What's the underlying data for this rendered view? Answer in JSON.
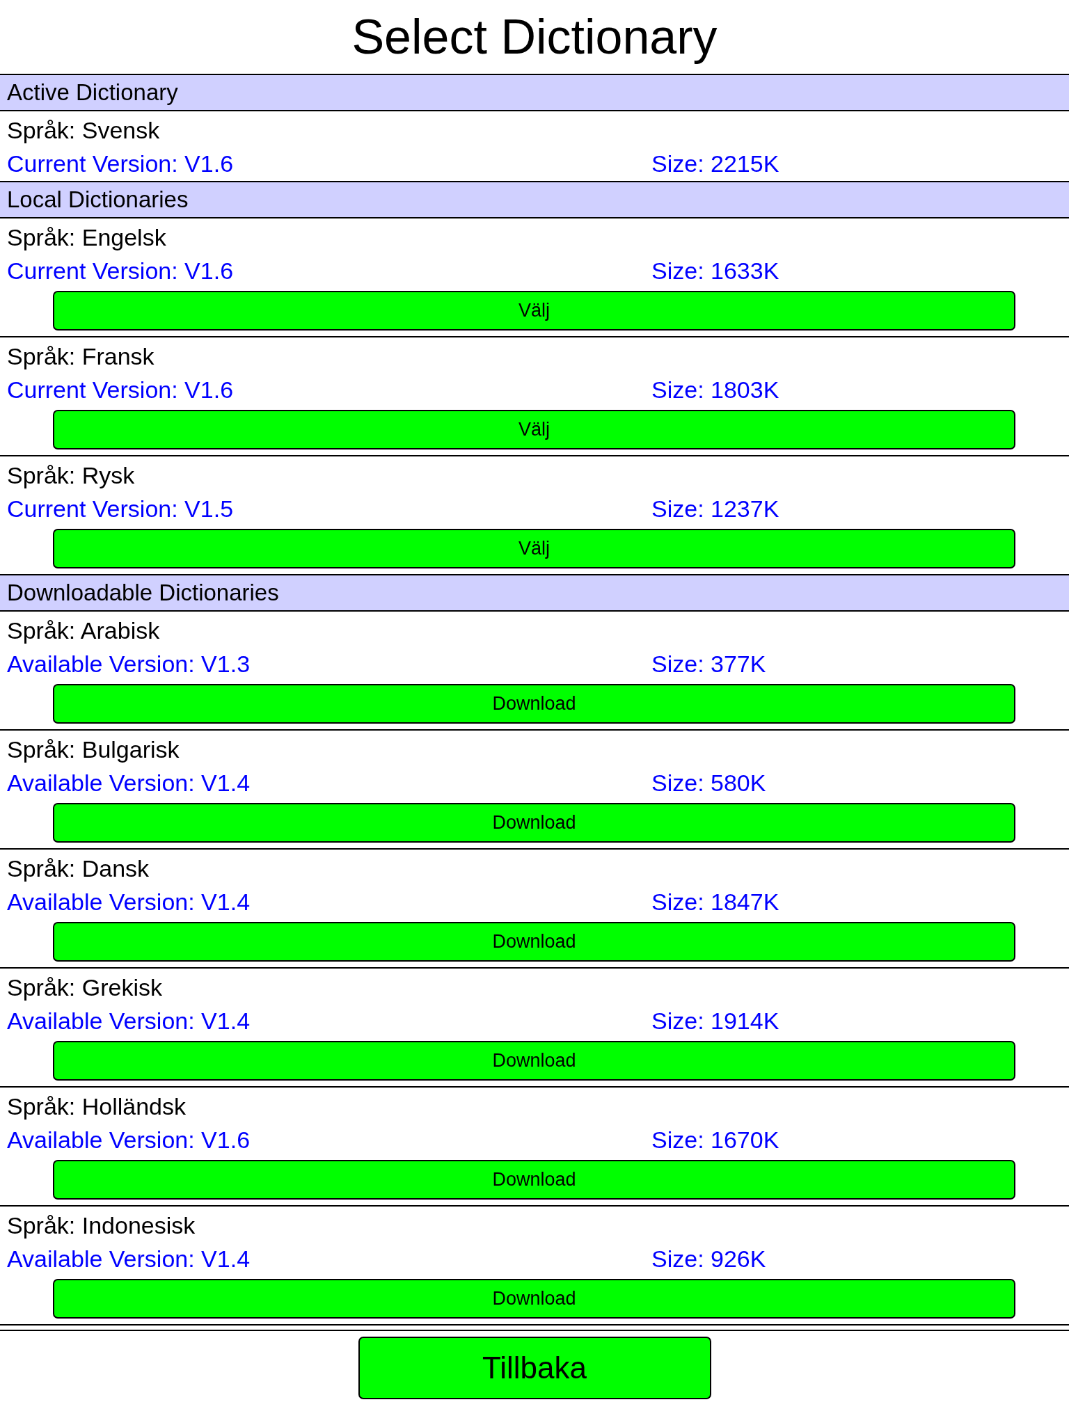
{
  "title": "Select Dictionary",
  "sections": [
    {
      "heading": "Active Dictionary",
      "items": [
        {
          "language": "Språk: Svensk",
          "version": "Current Version: V1.6",
          "size": "Size: 2215K"
        }
      ]
    },
    {
      "heading": "Local Dictionaries",
      "items": [
        {
          "language": "Språk: Engelsk",
          "version": "Current Version: V1.6",
          "size": "Size: 1633K",
          "button": "Välj"
        },
        {
          "language": "Språk: Fransk",
          "version": "Current Version: V1.6",
          "size": "Size: 1803K",
          "button": "Välj"
        },
        {
          "language": "Språk: Rysk",
          "version": "Current Version: V1.5",
          "size": "Size: 1237K",
          "button": "Välj"
        }
      ]
    },
    {
      "heading": "Downloadable Dictionaries",
      "items": [
        {
          "language": "Språk: Arabisk",
          "version": "Available Version: V1.3",
          "size": "Size: 377K",
          "button": "Download"
        },
        {
          "language": "Språk: Bulgarisk",
          "version": "Available Version: V1.4",
          "size": "Size: 580K",
          "button": "Download"
        },
        {
          "language": "Språk: Dansk",
          "version": "Available Version: V1.4",
          "size": "Size: 1847K",
          "button": "Download"
        },
        {
          "language": "Språk: Grekisk",
          "version": "Available Version: V1.4",
          "size": "Size: 1914K",
          "button": "Download"
        },
        {
          "language": "Språk: Holländsk",
          "version": "Available Version: V1.6",
          "size": "Size: 1670K",
          "button": "Download"
        },
        {
          "language": "Språk: Indonesisk",
          "version": "Available Version: V1.4",
          "size": "Size: 926K",
          "button": "Download"
        }
      ]
    }
  ],
  "back_button": "Tillbaka"
}
